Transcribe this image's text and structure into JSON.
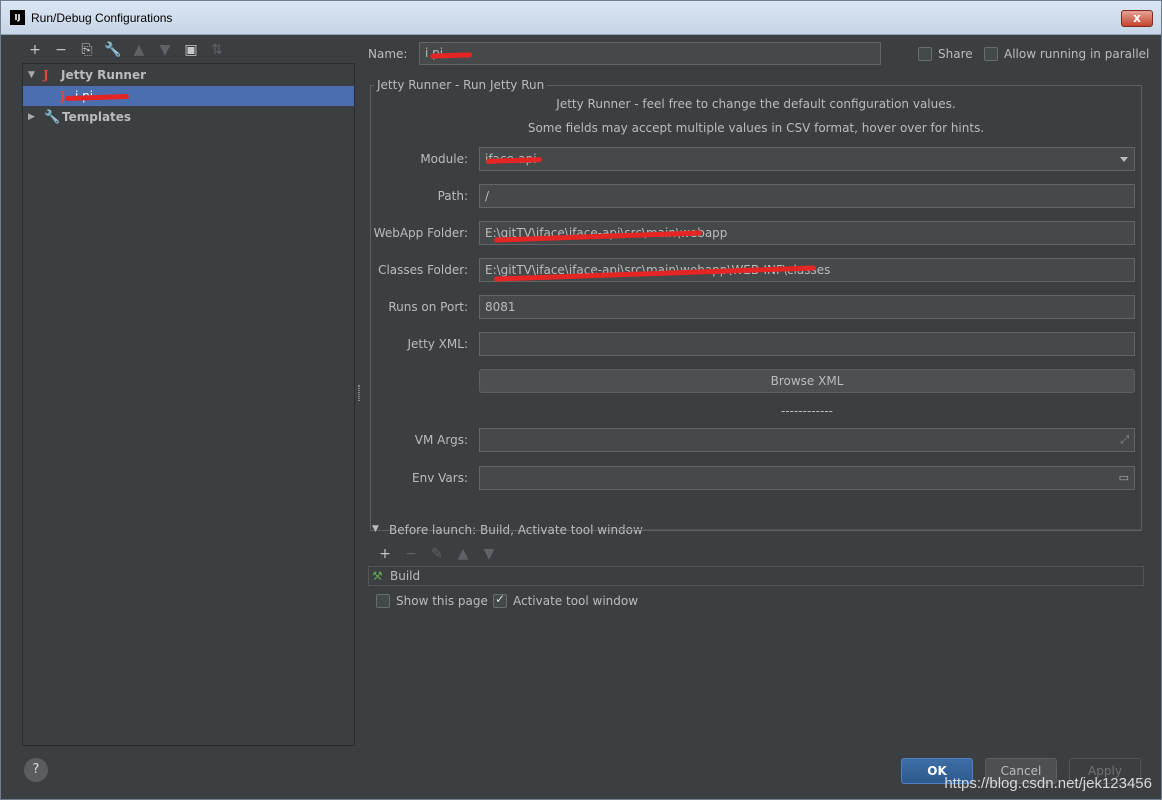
{
  "window": {
    "title": "Run/Debug Configurations",
    "icon": "IJ",
    "close": "x"
  },
  "left_toolbar": [
    "+",
    "−",
    "⎘",
    "🔧",
    "▲",
    "▼",
    "▣",
    "⇅"
  ],
  "tree": {
    "jetty_runner": "Jetty Runner",
    "config_item": "i      pi",
    "templates": "Templates"
  },
  "name_field": {
    "label": "Name:",
    "value": "i       pi"
  },
  "share_label": "Share",
  "parallel_label": "Allow running in parallel",
  "group": {
    "title": "Jetty Runner - Run Jetty Run",
    "desc1": "Jetty Runner - feel free to change the default configuration values.",
    "desc2": "Some fields may accept multiple values in CSV format, hover over for hints."
  },
  "fields": {
    "module": {
      "label": "Module:",
      "value": "iface-api"
    },
    "path": {
      "label": "Path:",
      "value": "/"
    },
    "webapp": {
      "label": "WebApp Folder:",
      "value": "E:\\gitTV\\iface\\iface-api\\src\\main\\webapp"
    },
    "classes": {
      "label": "Classes Folder:",
      "value": "E:\\gitTV\\iface\\iface-api\\src\\main\\webapp\\WEB-INF\\classes"
    },
    "port": {
      "label": "Runs on Port:",
      "value": "8081"
    },
    "jetty_xml": {
      "label": "Jetty XML:",
      "value": ""
    },
    "vm_args": {
      "label": "VM Args:",
      "value": ""
    },
    "env_vars": {
      "label": "Env Vars:",
      "value": ""
    }
  },
  "browse_xml": "Browse XML",
  "dashes": "------------",
  "before_launch": "Before launch: Build, Activate tool window",
  "before_toolbar": [
    "+",
    "−",
    "✎",
    "▲",
    "▼"
  ],
  "build_item": "Build",
  "show_page": "Show this page",
  "activate_tool": "Activate tool window",
  "buttons": {
    "ok": "OK",
    "cancel": "Cancel",
    "apply": "Apply",
    "help": "?"
  },
  "watermark": "https://blog.csdn.net/jek123456"
}
